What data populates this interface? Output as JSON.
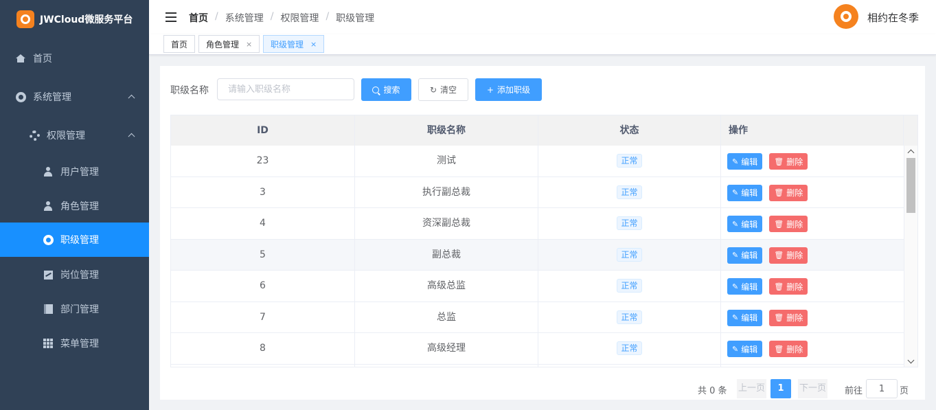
{
  "brand": {
    "title": "JWCloud微服务平台",
    "logo_icon": "brand-logo-icon"
  },
  "sidebar": {
    "items": [
      {
        "label": "首页",
        "icon": "home-icon"
      },
      {
        "label": "系统管理",
        "icon": "system-icon"
      },
      {
        "label": "权限管理",
        "icon": "gear-icon"
      },
      {
        "label": "用户管理",
        "icon": "user-icon"
      },
      {
        "label": "角色管理",
        "icon": "user-icon"
      },
      {
        "label": "职级管理",
        "icon": "circle-icon",
        "active": true
      },
      {
        "label": "岗位管理",
        "icon": "chart-icon"
      },
      {
        "label": "部门管理",
        "icon": "book-icon"
      },
      {
        "label": "菜单管理",
        "icon": "grid-icon"
      }
    ],
    "bg_color": "#304156",
    "active_color": "#1890ff"
  },
  "header": {
    "breadcrumbs": [
      "首页",
      "系统管理",
      "权限管理",
      "职级管理"
    ],
    "separator": "/",
    "user_name": "相约在冬季"
  },
  "tags": [
    {
      "label": "首页",
      "closable": false
    },
    {
      "label": "角色管理",
      "closable": true,
      "close": "×"
    },
    {
      "label": "职级管理",
      "closable": true,
      "close": "×",
      "active": true
    }
  ],
  "search": {
    "label": "职级名称",
    "placeholder": "请输入职级名称",
    "value": "",
    "search_button": "搜索",
    "clear_button": "清空",
    "add_button": "添加职级",
    "clear_icon": "↻",
    "add_icon": "+"
  },
  "table": {
    "columns": [
      "ID",
      "职级名称",
      "状态",
      "操作"
    ],
    "rows": [
      {
        "id": "23",
        "name": "测试",
        "status": "正常"
      },
      {
        "id": "3",
        "name": "执行副总裁",
        "status": "正常"
      },
      {
        "id": "4",
        "name": "资深副总裁",
        "status": "正常"
      },
      {
        "id": "5",
        "name": "副总裁",
        "status": "正常"
      },
      {
        "id": "6",
        "name": "高级总监",
        "status": "正常"
      },
      {
        "id": "7",
        "name": "总监",
        "status": "正常"
      },
      {
        "id": "8",
        "name": "高级经理",
        "status": "正常"
      }
    ],
    "edit_label": "编辑",
    "delete_label": "删除",
    "edit_icon": "✎",
    "delete_icon": "🗑"
  },
  "pagination": {
    "total_text": "共 0 条",
    "prev": "上一页",
    "current": "1",
    "next": "下一页",
    "goto_label": "前往",
    "goto_value": "1",
    "page_suffix": "页"
  },
  "colors": {
    "primary": "#409eff",
    "danger": "#f56c6c",
    "brand_orange": "#f5821f"
  }
}
